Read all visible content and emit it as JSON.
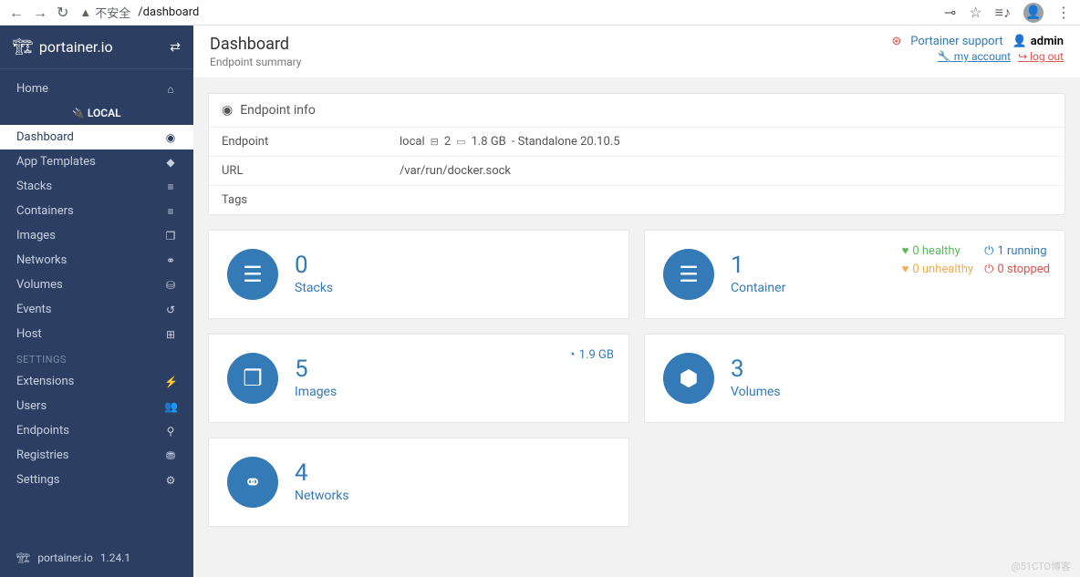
{
  "browser": {
    "security_text": "不安全",
    "url_suffix": "/dashboard"
  },
  "logo": "portainer.io",
  "sidebar": {
    "home": "Home",
    "group": "LOCAL",
    "items": [
      {
        "label": "Dashboard",
        "icon": "◉"
      },
      {
        "label": "App Templates",
        "icon": "◆"
      },
      {
        "label": "Stacks",
        "icon": "≡"
      },
      {
        "label": "Containers",
        "icon": "≡"
      },
      {
        "label": "Images",
        "icon": "❐"
      },
      {
        "label": "Networks",
        "icon": "⚭"
      },
      {
        "label": "Volumes",
        "icon": "⛁"
      },
      {
        "label": "Events",
        "icon": "↺"
      },
      {
        "label": "Host",
        "icon": "⊞"
      }
    ],
    "section": "SETTINGS",
    "settings": [
      {
        "label": "Extensions",
        "icon": "⚡"
      },
      {
        "label": "Users",
        "icon": "👥"
      },
      {
        "label": "Endpoints",
        "icon": "⚲"
      },
      {
        "label": "Registries",
        "icon": "⛃"
      },
      {
        "label": "Settings",
        "icon": "⚙"
      }
    ],
    "footer_brand": "portainer.io",
    "footer_version": "1.24.1"
  },
  "header": {
    "title": "Dashboard",
    "subtitle": "Endpoint summary",
    "support": "Portainer support",
    "user": "admin",
    "account_link": "my account",
    "logout_link": "log out"
  },
  "endpoint_panel": {
    "title": "Endpoint info",
    "rows": {
      "endpoint_label": "Endpoint",
      "endpoint_name": "local",
      "cpu": "2",
      "ram": "1.8 GB",
      "runtime": "- Standalone 20.10.5",
      "url_label": "URL",
      "url_value": "/var/run/docker.sock",
      "tags_label": "Tags"
    }
  },
  "tiles": {
    "stacks": {
      "count": "0",
      "label": "Stacks"
    },
    "containers": {
      "count": "1",
      "label": "Container",
      "healthy": "0 healthy",
      "running": "1 running",
      "unhealthy": "0 unhealthy",
      "stopped": "0 stopped"
    },
    "images": {
      "count": "5",
      "label": "Images",
      "size": "1.9 GB"
    },
    "volumes": {
      "count": "3",
      "label": "Volumes"
    },
    "networks": {
      "count": "4",
      "label": "Networks"
    }
  },
  "watermark": "@51CTO博客"
}
